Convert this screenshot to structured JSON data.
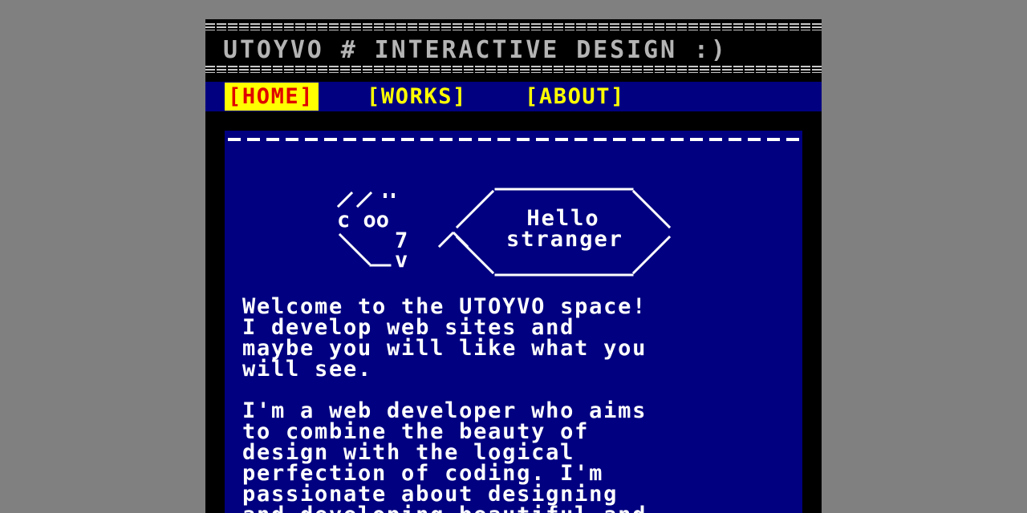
{
  "header": {
    "title": "UTOYVO # INTERACTIVE DESIGN :)"
  },
  "nav": {
    "items": [
      {
        "label": "[HOME]",
        "active": true
      },
      {
        "label": "[WORKS]",
        "active": false
      },
      {
        "label": "[ABOUT]",
        "active": false
      }
    ]
  },
  "ascii": {
    "greeting_line1": "Hello",
    "greeting_line2": "stranger",
    "face_line2": "c oo",
    "face_line3": "7",
    "face_line4": "v"
  },
  "main": {
    "paragraph1": "Welcome to the UTOYVO space!\nI develop web sites and\nmaybe you will like what you\nwill see.",
    "paragraph2": "I'm a web developer who aims\nto combine the beauty of\ndesign with the logical\nperfection of coding. I'm\npassionate about designing\nand developing beautiful and"
  },
  "colors": {
    "page_background": "#808080",
    "frame": "#000000",
    "panel": "#000080",
    "title_text": "#b4b4b4",
    "nav_text": "#ffff00",
    "nav_active_bg": "#ffff00",
    "nav_active_text": "#e00000",
    "body_text": "#ffffff"
  }
}
